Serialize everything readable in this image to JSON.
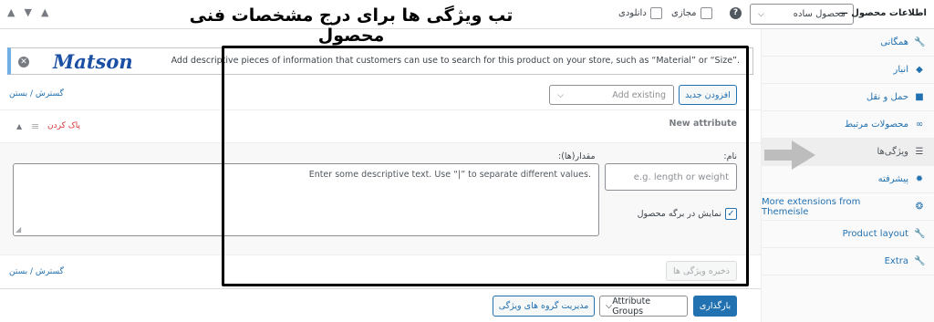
{
  "header": {
    "collapse_arrows": [
      "▲",
      "▼",
      "▲"
    ],
    "overlay_title": "تب ویژگی ها برای درج مشخصات فنی محصول",
    "downloadable_label": "دانلودی",
    "virtual_label": "مجازی",
    "help_symbol": "?",
    "product_type_value": "محصول ساده",
    "product_data_label": "اطلاعات محصول —"
  },
  "tabs": [
    {
      "label": "همگانی",
      "icon": "wrench-icon",
      "glyph": "🔧"
    },
    {
      "label": "انبار",
      "icon": "tag-icon",
      "glyph": "◆"
    },
    {
      "label": "حمل و نقل",
      "icon": "truck-icon",
      "glyph": "■"
    },
    {
      "label": "محصولات مرتبط",
      "icon": "link-icon",
      "glyph": "∞"
    },
    {
      "label": "ویژگی‌ها",
      "icon": "list-icon",
      "glyph": "☰"
    },
    {
      "label": "پیشرفته",
      "icon": "gear-icon",
      "glyph": "✹"
    },
    {
      "label": "More extensions from Themeisle",
      "icon": "plugin-icon",
      "glyph": "❂"
    },
    {
      "label": "Product layout",
      "icon": "wrench-icon",
      "glyph": "🔧"
    },
    {
      "label": "Extra",
      "icon": "wrench-icon",
      "glyph": "🔧"
    }
  ],
  "notice": {
    "text": "Add descriptive pieces of information that customers can use to search for this product on your store, such as “Material” or “Size”.",
    "dismiss_symbol": "✕",
    "logo_text": "Matson"
  },
  "expand_collapse_label": "گسترش / بستن",
  "add_new_label": "افزودن جدید",
  "add_existing_placeholder": "Add existing",
  "attribute": {
    "heading": "New attribute",
    "remove_label": "پاک کردن",
    "name_label": "نام:",
    "name_placeholder": "e.g. length or weight",
    "values_label": "مقدار(ها):",
    "values_placeholder": "Enter some descriptive text. Use “|” to separate different values.",
    "visible_label": "نمایش در برگه محصول",
    "visible_checked": true
  },
  "save_attributes_label": "ذخیره ویژگی ها",
  "footer": {
    "load_label": "بارگذاری",
    "groups_select_value": "Attribute Groups",
    "manage_groups_label": "مدیریت گروه های ویژگی"
  },
  "colors": {
    "accent": "#2271b1",
    "danger": "#d63638",
    "highlight_border": "#000000"
  }
}
